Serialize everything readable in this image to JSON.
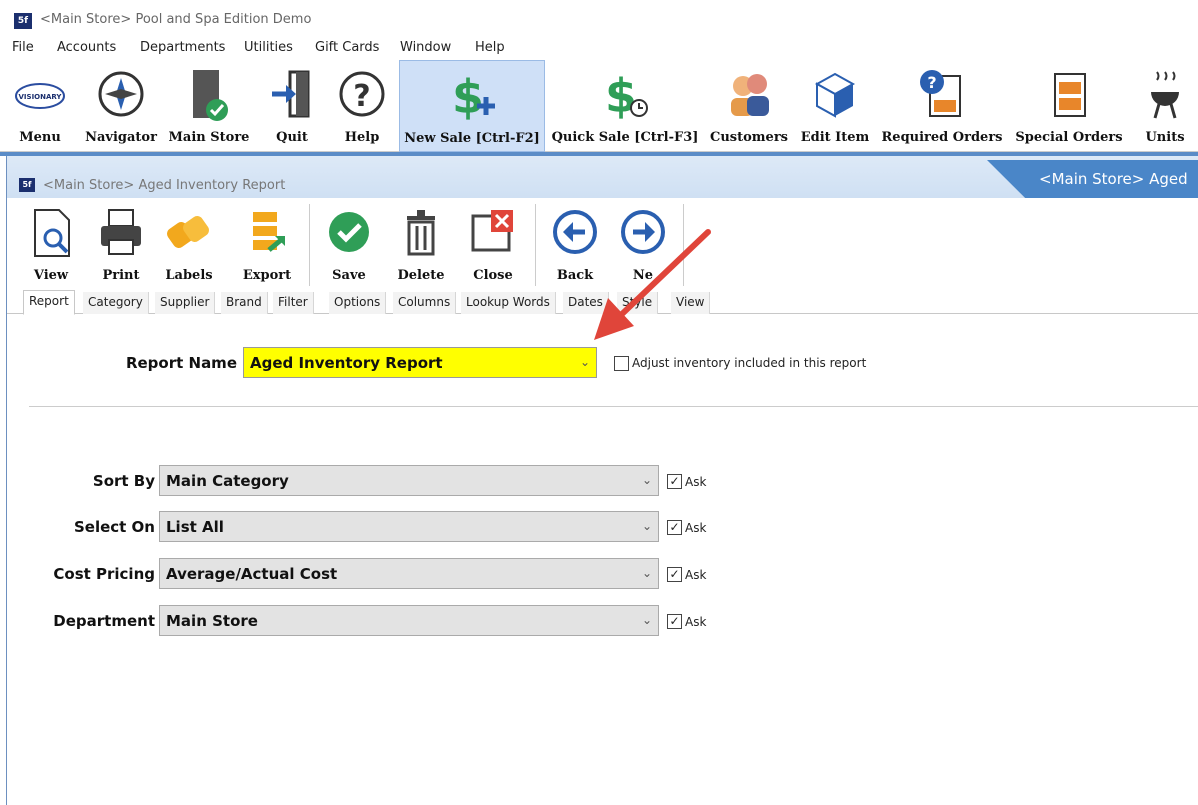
{
  "window": {
    "title": "<Main Store> Pool and Spa Edition Demo",
    "logo_text": "5f"
  },
  "menu": [
    "File",
    "Accounts",
    "Departments",
    "Utilities",
    "Gift Cards",
    "Window",
    "Help"
  ],
  "main_toolbar": {
    "menu": "Menu",
    "navigator": "Navigator",
    "main_store": "Main Store",
    "quit": "Quit",
    "help": "Help",
    "new_sale": "New Sale [Ctrl-F2]",
    "quick_sale": "Quick Sale [Ctrl-F3]",
    "customers": "Customers",
    "edit_item": "Edit Item",
    "required_orders": "Required Orders",
    "special_orders": "Special Orders",
    "units": "Units",
    "logo_text": "VISIONARY"
  },
  "report_window": {
    "caption": "<Main Store> Aged Inventory Report",
    "tab_caption": "<Main Store> Aged",
    "toolbar": {
      "view": "View",
      "print": "Print",
      "labels": "Labels",
      "export": "Export",
      "save": "Save",
      "delete": "Delete",
      "close": "Close",
      "back": "Back",
      "next": "Ne"
    },
    "tabs": [
      "Report",
      "Category",
      "Supplier",
      "Brand",
      "Filter",
      "Options",
      "Columns",
      "Lookup Words",
      "Dates",
      "Style",
      "View"
    ],
    "selected_tab": "Report"
  },
  "form": {
    "report_name_label": "Report Name",
    "report_name_value": "Aged Inventory Report",
    "adjust_label": "Adjust inventory included in this report",
    "adjust_checked": false,
    "fields": [
      {
        "label": "Sort By",
        "value": "Main Category",
        "ask": "Ask",
        "ask_checked": true
      },
      {
        "label": "Select On",
        "value": "List All",
        "ask": "Ask",
        "ask_checked": true
      },
      {
        "label": "Cost Pricing",
        "value": "Average/Actual Cost",
        "ask": "Ask",
        "ask_checked": true
      },
      {
        "label": "Department",
        "value": "Main Store",
        "ask": "Ask",
        "ask_checked": true
      }
    ]
  },
  "colors": {
    "accent": "#4a86c8",
    "highlight": "#ffff00",
    "arrow": "#e0453a"
  }
}
